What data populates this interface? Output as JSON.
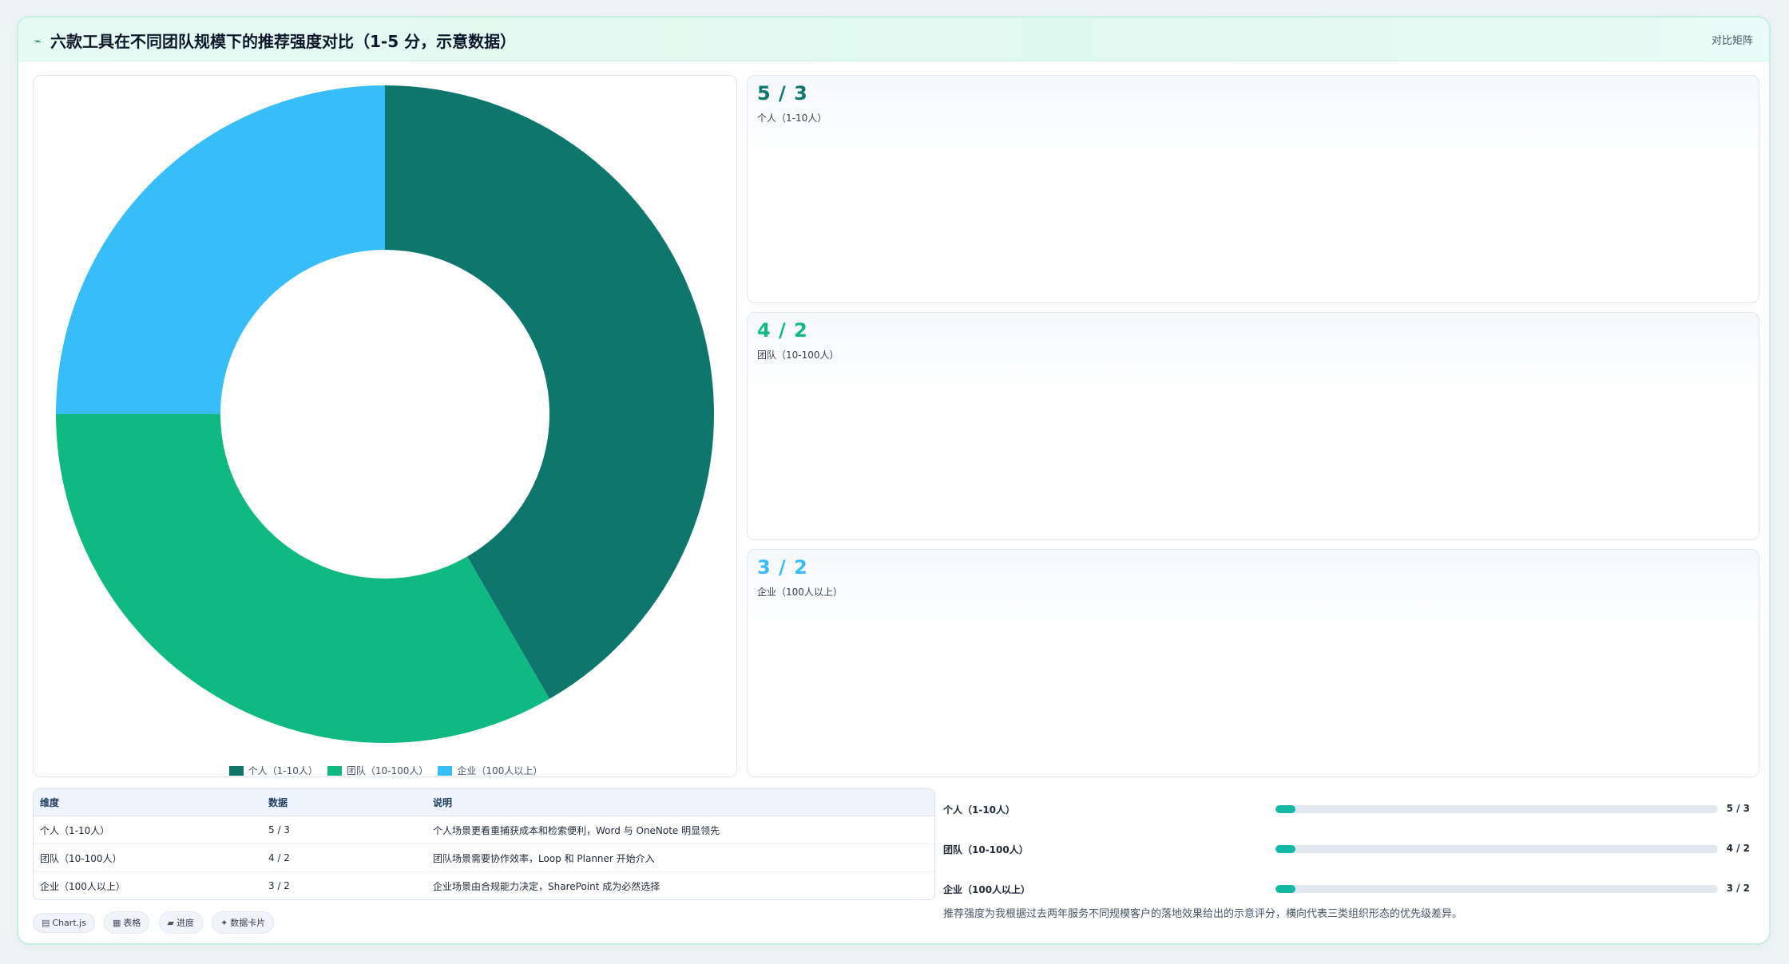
{
  "header": {
    "icon": "chart-line-icon",
    "title": "六款工具在不同团队规模下的推荐强度对比（1-5 分，示意数据）",
    "tag": "对比矩阵"
  },
  "chart_data": {
    "type": "doughnut",
    "categories": [
      "个人（1-10人）",
      "团队（10-100人）",
      "企业（100人以上）"
    ],
    "values": [
      5,
      4,
      3
    ],
    "colors": [
      "#0f766e",
      "#10b981",
      "#38bdf8"
    ],
    "legend_position": "bottom"
  },
  "stats": [
    {
      "value": "5 / 3",
      "label": "个人（1-10人）",
      "color": "#0f766e"
    },
    {
      "value": "4 / 2",
      "label": "团队（10-100人）",
      "color": "#10b981"
    },
    {
      "value": "3 / 2",
      "label": "企业（100人以上）",
      "color": "#38bdf8"
    }
  ],
  "table": {
    "headers": [
      "维度",
      "数据",
      "说明"
    ],
    "rows": [
      [
        "个人（1-10人）",
        "5 / 3",
        "个人场景更看重捕获成本和检索便利，Word 与 OneNote 明显领先"
      ],
      [
        "团队（10-100人）",
        "4 / 2",
        "团队场景需要协作效率，Loop 和 Planner 开始介入"
      ],
      [
        "企业（100人以上）",
        "3 / 2",
        "企业场景由合规能力决定，SharePoint 成为必然选择"
      ]
    ]
  },
  "chips": [
    {
      "icon": "chart-icon",
      "glyph": "▤",
      "label": "Chart.js"
    },
    {
      "icon": "table-icon",
      "glyph": "▦",
      "label": "表格"
    },
    {
      "icon": "progress-icon",
      "glyph": "▰",
      "label": "进度"
    },
    {
      "icon": "card-icon",
      "glyph": "✦",
      "label": "数据卡片"
    }
  ],
  "progress": [
    {
      "label": "个人（1-10人）",
      "value": "5 / 3",
      "fraction": 0.045
    },
    {
      "label": "团队（10-100人）",
      "value": "4 / 2",
      "fraction": 0.045
    },
    {
      "label": "企业（100人以上）",
      "value": "3 / 2",
      "fraction": 0.045
    }
  ],
  "note": "推荐强度为我根据过去两年服务不同规模客户的落地效果给出的示意评分，横向代表三类组织形态的优先级差异。"
}
